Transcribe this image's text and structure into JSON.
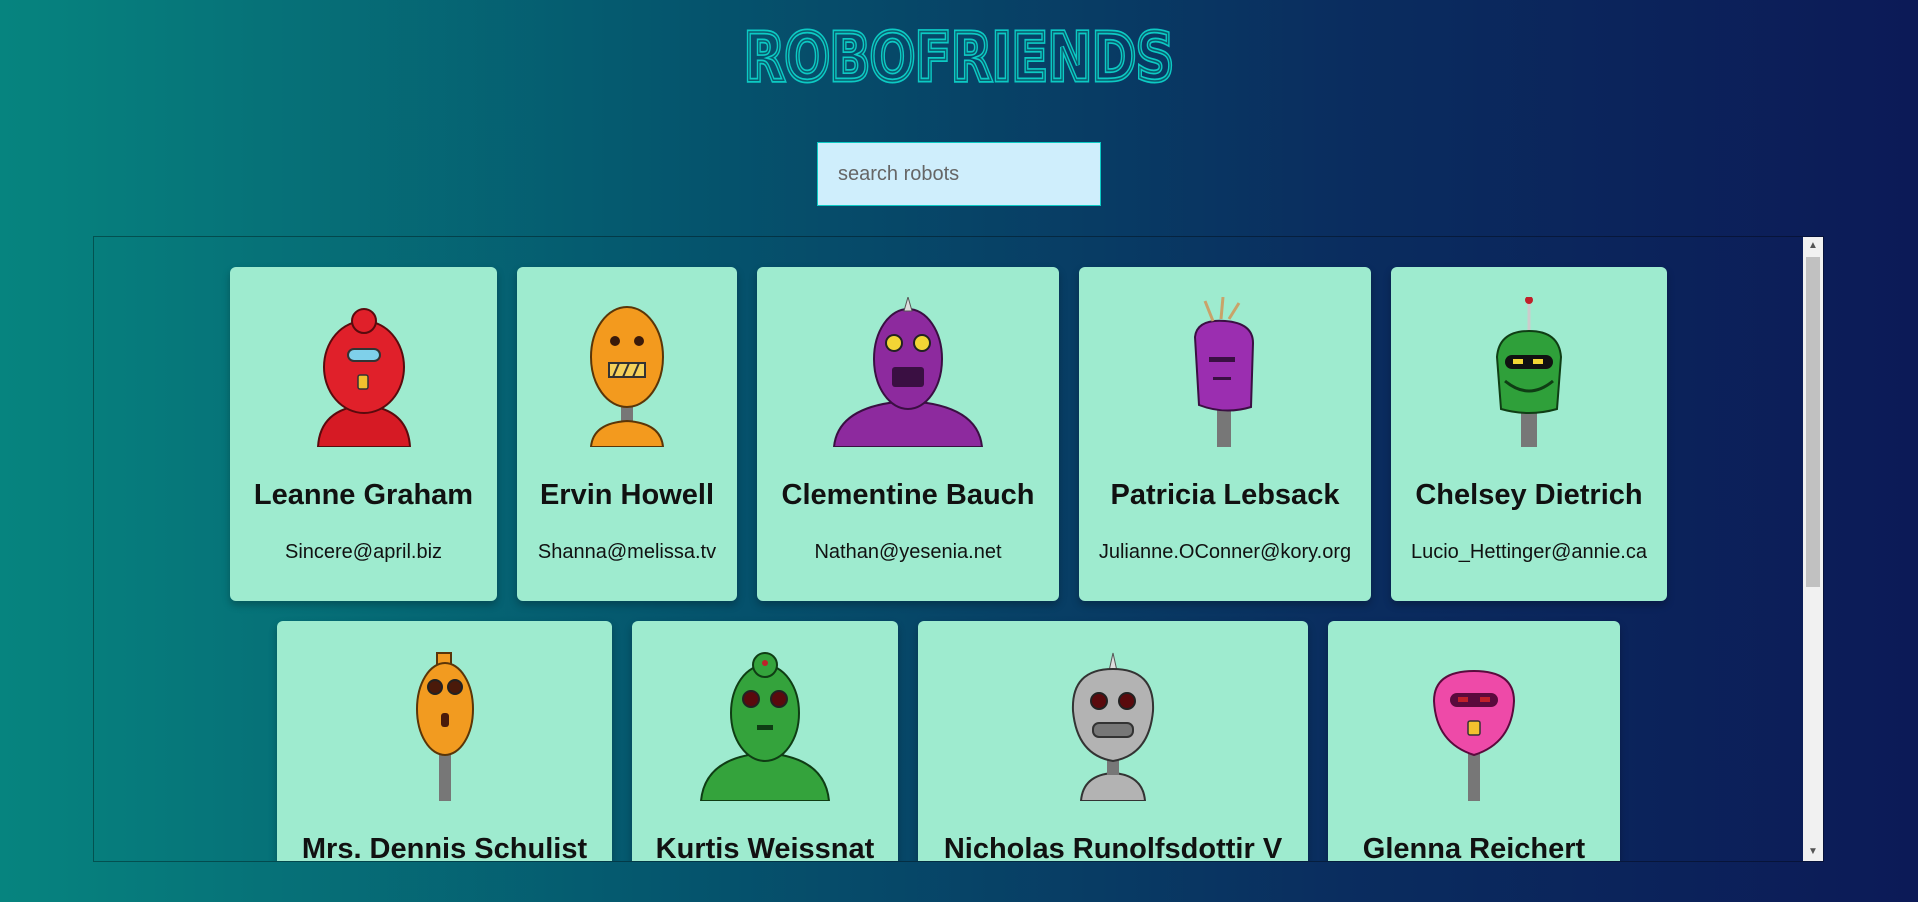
{
  "app": {
    "title": "ROBOFRIENDS",
    "title_color": "#0ccac4"
  },
  "search": {
    "placeholder": "search robots",
    "value": ""
  },
  "robots": [
    {
      "name": "Leanne Graham",
      "email": "Sincere@april.biz",
      "color": "#e0202a"
    },
    {
      "name": "Ervin Howell",
      "email": "Shanna@melissa.tv",
      "color": "#f39a1e"
    },
    {
      "name": "Clementine Bauch",
      "email": "Nathan@yesenia.net",
      "color": "#8d2a9e"
    },
    {
      "name": "Patricia Lebsack",
      "email": "Julianne.OConner@kory.org",
      "color": "#9b2eb0"
    },
    {
      "name": "Chelsey Dietrich",
      "email": "Lucio_Hettinger@annie.ca",
      "color": "#2fa03a"
    },
    {
      "name": "Mrs. Dennis Schulist",
      "email": "",
      "color": "#f29b20"
    },
    {
      "name": "Kurtis Weissnat",
      "email": "",
      "color": "#34a33c"
    },
    {
      "name": "Nicholas Runolfsdottir V",
      "email": "",
      "color": "#b3b3b3"
    },
    {
      "name": "Glenna Reichert",
      "email": "",
      "color": "#ee4aa8"
    }
  ],
  "scrollbar": {
    "up_icon": "arrow-up-icon",
    "down_icon": "arrow-down-icon"
  }
}
